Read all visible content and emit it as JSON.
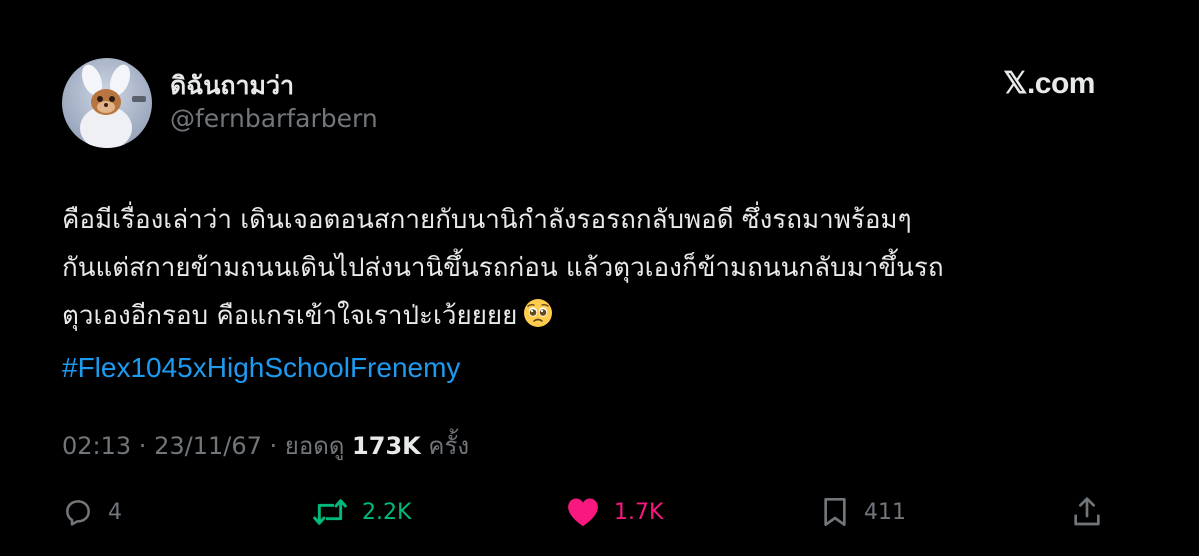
{
  "author": {
    "display_name": "ดิฉันถามว่า",
    "handle": "@fernbarfarbern"
  },
  "brand": {
    "logo_text": "𝕏.com"
  },
  "tweet": {
    "lines": [
      "คือมีเรื่องเล่าว่า เดินเจอตอนสกายกับนานิกำลังรอรถกลับพอดี ซึ่งรถมาพร้อมๆ",
      "กันแต่สกายข้ามถนนเดินไปส่งนานิขึ้นรถก่อน แล้วตุวเองก็ข้ามถนนกลับมาขึ้นรถ",
      "ตุวเองอีกรอบ คือแกรเข้าใจเราป่ะเว้ยยยย"
    ],
    "emoji": "pleading-face-emoji",
    "hashtag": "#Flex1045xHighSchoolFrenemy"
  },
  "meta": {
    "time": "02:13",
    "sep1": " · ",
    "date": "23/11/67",
    "sep2": " · ",
    "views_label": "ยอดดู",
    "views_count": "173K",
    "views_unit": "ครั้ง"
  },
  "actions": {
    "reply": {
      "icon": "reply-icon",
      "count": "4"
    },
    "repost": {
      "icon": "repost-icon",
      "count": "2.2K"
    },
    "like": {
      "icon": "heart-icon",
      "count": "1.7K"
    },
    "bookmark": {
      "icon": "bookmark-icon",
      "count": "411"
    },
    "share": {
      "icon": "share-icon"
    }
  },
  "colors": {
    "background": "#000000",
    "text": "#e7e9ea",
    "secondary": "#71767b",
    "hashtag": "#1d9bf0",
    "repost": "#00ba7c",
    "like": "#f91880"
  }
}
